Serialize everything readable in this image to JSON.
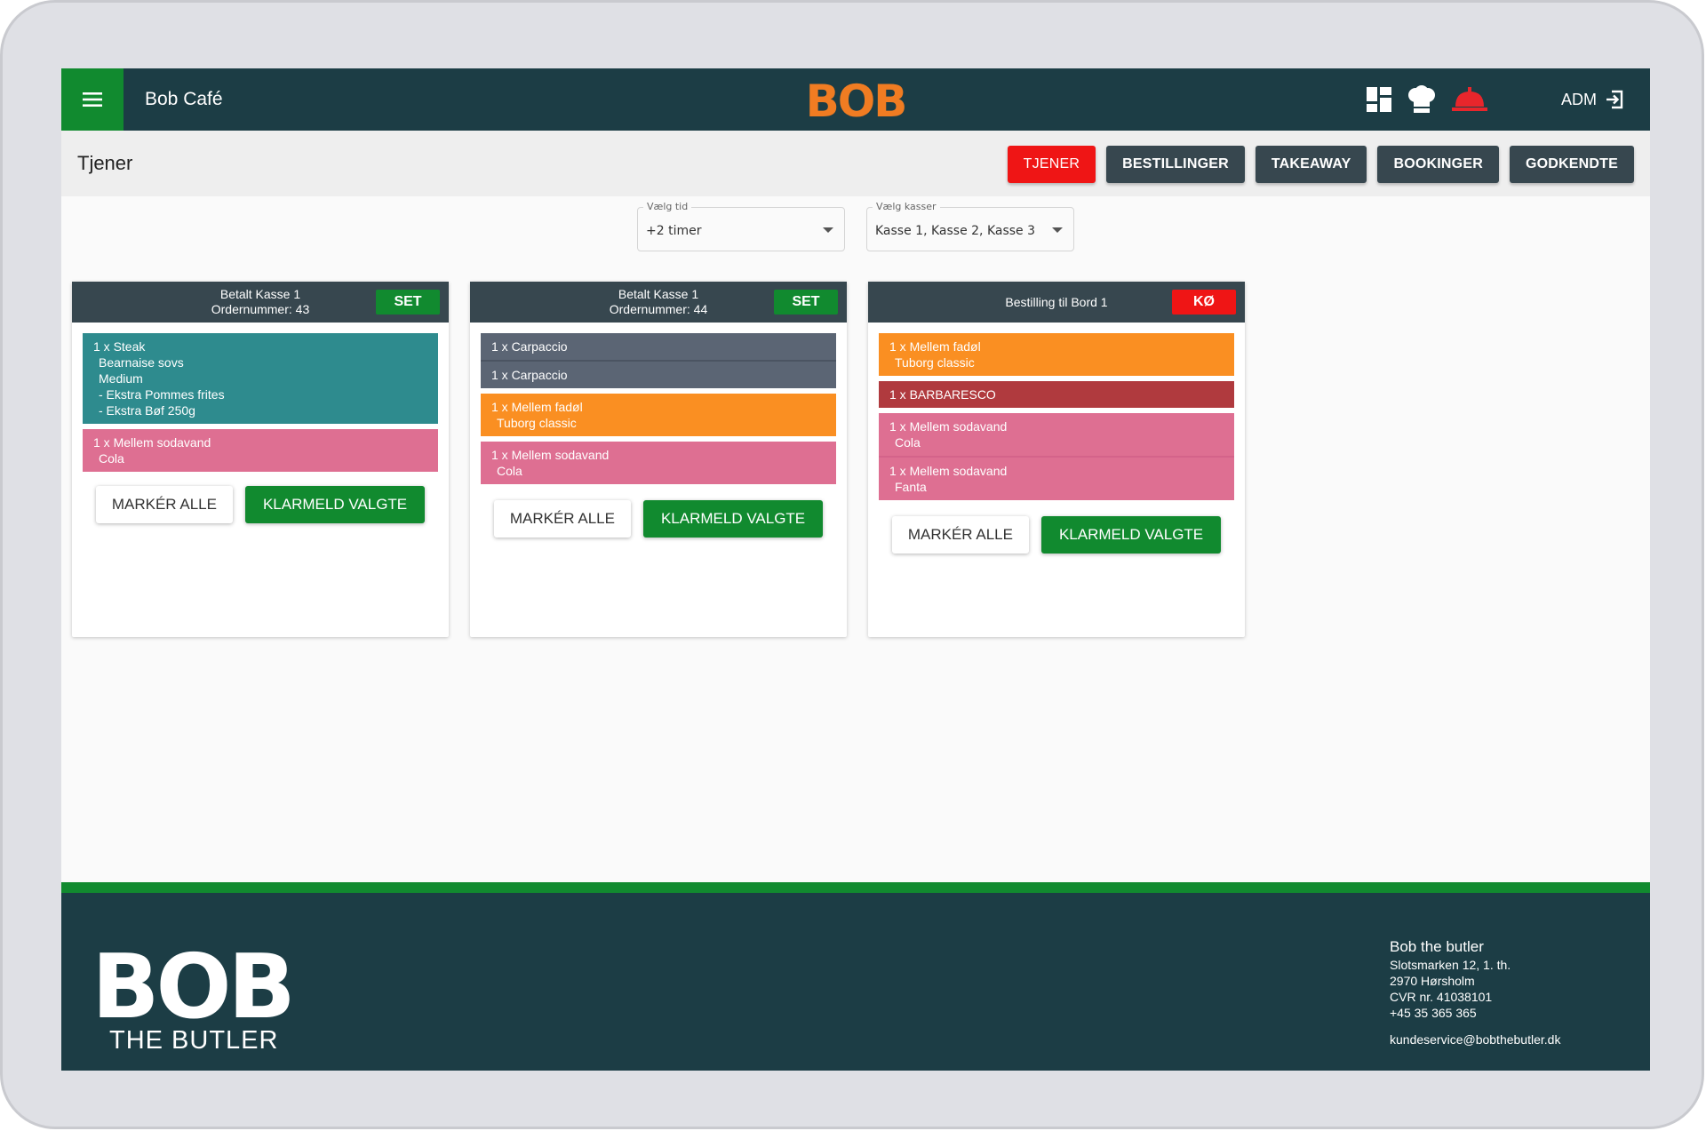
{
  "app": {
    "title": "Bob Café",
    "logo_text": "BOB",
    "user_label": "ADM"
  },
  "icons": {
    "menu": "hamburger-menu-icon",
    "dashboard": "dashboard-grid-icon",
    "chef": "chef-hat-icon",
    "bell": "service-bell-icon",
    "logout": "logout-icon"
  },
  "colors": {
    "primary_dark": "#1c3d45",
    "brand_green": "#118a2f",
    "brand_orange": "#f07c22",
    "active_red": "#ef1515",
    "bell_red": "#e8262c"
  },
  "page": {
    "title": "Tjener"
  },
  "nav": {
    "tabs": [
      {
        "label": "TJENER",
        "active": true
      },
      {
        "label": "BESTILLINGER",
        "active": false
      },
      {
        "label": "TAKEAWAY",
        "active": false
      },
      {
        "label": "BOOKINGER",
        "active": false
      },
      {
        "label": "GODKENDTE",
        "active": false
      }
    ]
  },
  "filters": {
    "time": {
      "label": "Vælg tid",
      "value": "+2 timer"
    },
    "registers": {
      "label": "Vælg kasser",
      "value": "Kasse 1, Kasse 2, Kasse 3"
    }
  },
  "orders": [
    {
      "header_line1": "Betalt Kasse 1",
      "header_line2": "Ordernummer: 43",
      "badge": "SET",
      "items": [
        {
          "line": "1 x Steak",
          "details": [
            "Bearnaise sovs",
            "Medium",
            "- Ekstra Pommes frites",
            "- Ekstra Bøf 250g"
          ]
        },
        {
          "line": "1 x Mellem sodavand",
          "details": [
            "Cola"
          ]
        }
      ]
    },
    {
      "header_line1": "Betalt Kasse 1",
      "header_line2": "Ordernummer: 44",
      "badge": "SET",
      "items": [
        {
          "line": "1 x Carpaccio",
          "details": []
        },
        {
          "line": "1 x Carpaccio",
          "details": []
        },
        {
          "line": "1 x Mellem fadøl",
          "details": [
            "Tuborg classic"
          ]
        },
        {
          "line": "1 x Mellem sodavand",
          "details": [
            "Cola"
          ]
        }
      ]
    },
    {
      "header_line1": "Bestilling til Bord 1",
      "badge": "KØ",
      "items": [
        {
          "line": "1 x Mellem fadøl",
          "details": [
            "Tuborg classic"
          ]
        },
        {
          "line": "1 x BARBARESCO",
          "details": []
        },
        {
          "line": "1 x Mellem sodavand",
          "details": [
            "Cola"
          ]
        },
        {
          "line": "1 x Mellem sodavand",
          "details": [
            "Fanta"
          ]
        }
      ]
    }
  ],
  "actions": {
    "mark_all": "MARKÉR ALLE",
    "ready_selected": "KLARMELD VALGTE"
  },
  "footer": {
    "logo_text": "BOB",
    "logo_sub": "THE BUTLER",
    "company": "Bob the butler",
    "address1": "Slotsmarken 12, 1. th.",
    "address2": "2970 Hørsholm",
    "cvr": "CVR nr. 41038101",
    "phone": "+45 35 365 365",
    "email": "kundeservice@bobthebutler.dk"
  }
}
